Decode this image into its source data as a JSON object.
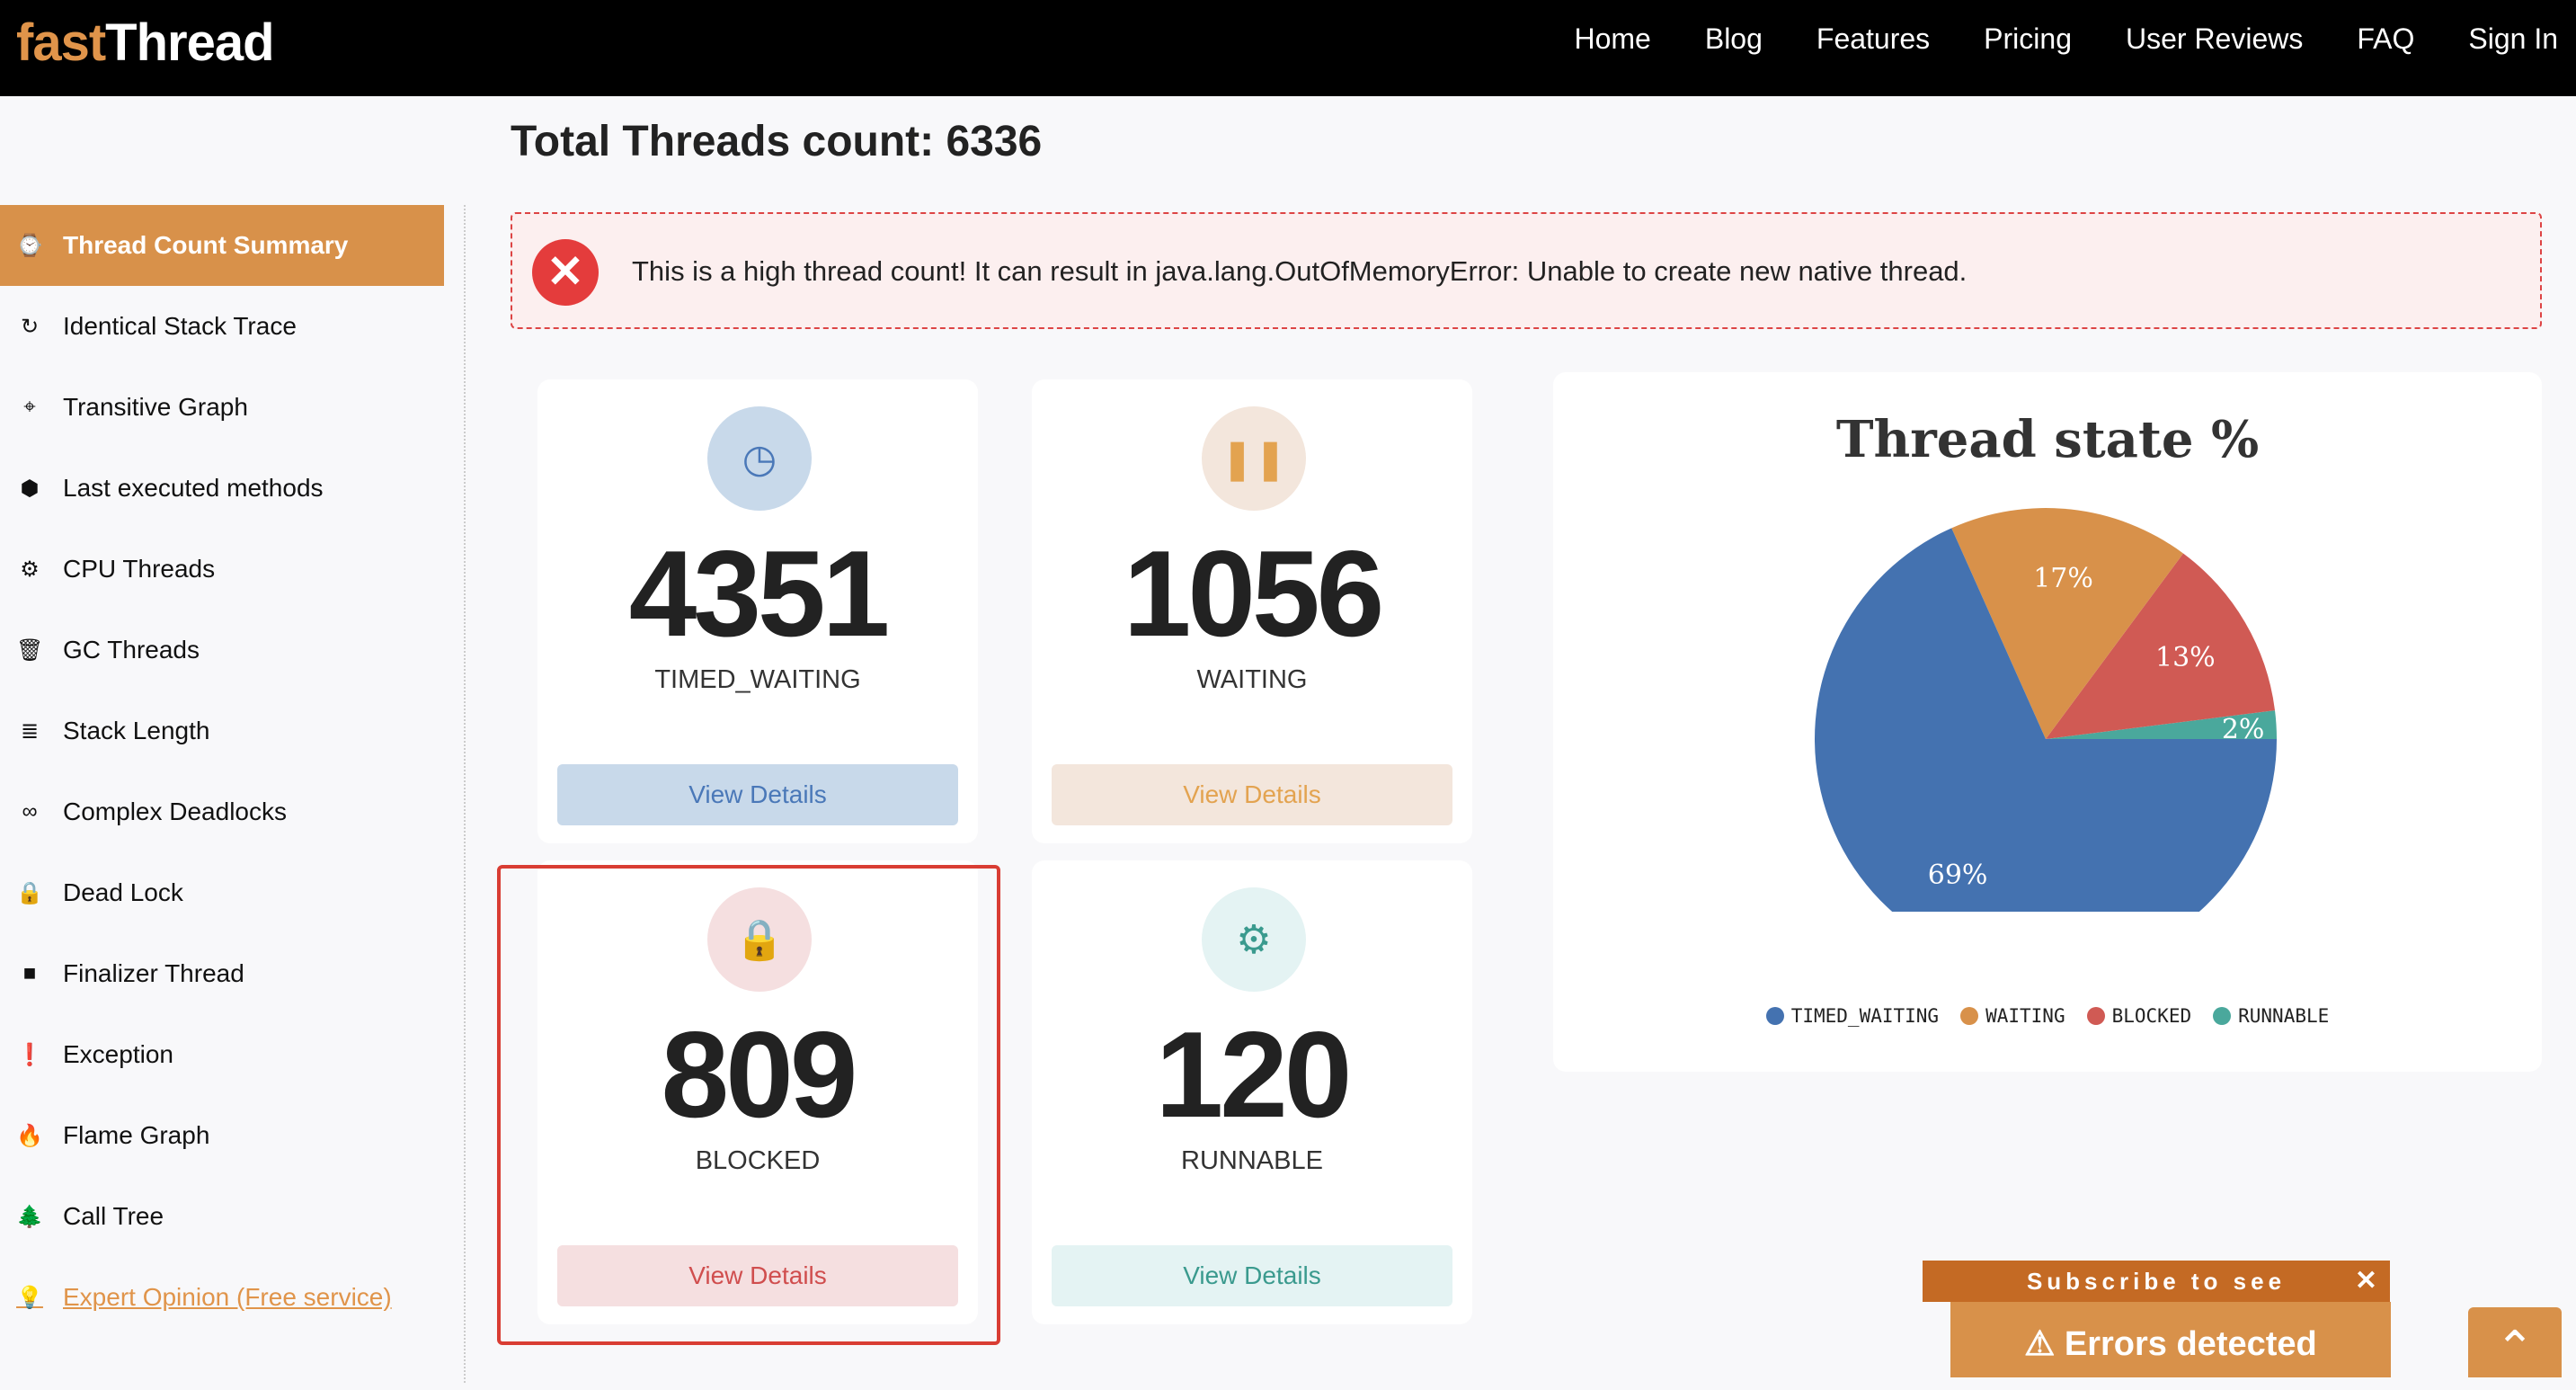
{
  "brand": {
    "part1": "fast",
    "part2": "Thread"
  },
  "nav": [
    "Home",
    "Blog",
    "Features",
    "Pricing",
    "User Reviews",
    "FAQ",
    "Sign In"
  ],
  "sidebar": [
    {
      "label": "Thread Count Summary",
      "icon": "dashboard-icon",
      "glyph": "⌚"
    },
    {
      "label": "Identical Stack Trace",
      "icon": "refresh-icon",
      "glyph": "↻"
    },
    {
      "label": "Transitive Graph",
      "icon": "crosshair-icon",
      "glyph": "⌖"
    },
    {
      "label": "Last executed methods",
      "icon": "cubes-icon",
      "glyph": "⬢"
    },
    {
      "label": "CPU Threads",
      "icon": "cogs-icon",
      "glyph": "⚙"
    },
    {
      "label": "GC Threads",
      "icon": "trash-icon",
      "glyph": "🗑"
    },
    {
      "label": "Stack Length",
      "icon": "sort-icon",
      "glyph": "≣"
    },
    {
      "label": "Complex Deadlocks",
      "icon": "link-icon",
      "glyph": "∞"
    },
    {
      "label": "Dead Lock",
      "icon": "lock-icon",
      "glyph": "🔒"
    },
    {
      "label": "Finalizer Thread",
      "icon": "square-icon",
      "glyph": "■"
    },
    {
      "label": "Exception",
      "icon": "exclamation-icon",
      "glyph": "❗"
    },
    {
      "label": "Flame Graph",
      "icon": "fire-icon",
      "glyph": "🔥"
    },
    {
      "label": "Call Tree",
      "icon": "tree-icon",
      "glyph": "🌲"
    }
  ],
  "expert": {
    "label": "Expert Opinion (Free service)",
    "icon": "lightbulb-icon",
    "glyph": "💡"
  },
  "page_title": "Total Threads count: 6336",
  "alert": "This is a high thread count! It can result in java.lang.OutOfMemoryError: Unable to create new native thread.",
  "cards": [
    {
      "count": "4351",
      "label": "TIMED_WAITING",
      "button": "View Details",
      "icon": "clock-icon",
      "glyph": "◷",
      "color": "#4a78b8",
      "bg": "#c8d9ea"
    },
    {
      "count": "1056",
      "label": "WAITING",
      "button": "View Details",
      "icon": "pause-icon",
      "glyph": "❚❚",
      "color": "#e3a350",
      "bg": "#f3e6dc"
    },
    {
      "count": "809",
      "label": "BLOCKED",
      "button": "View Details",
      "icon": "lock-icon",
      "glyph": "🔒",
      "color": "#d04e4e",
      "bg": "#f5dfe0"
    },
    {
      "count": "120",
      "label": "RUNNABLE",
      "button": "View Details",
      "icon": "gear-icon",
      "glyph": "⚙",
      "color": "#3a9a8e",
      "bg": "#e4f3f3"
    }
  ],
  "chart_data": {
    "type": "pie",
    "title": "Thread state %",
    "categories": [
      "TIMED_WAITING",
      "WAITING",
      "BLOCKED",
      "RUNNABLE"
    ],
    "values": [
      69,
      17,
      13,
      2
    ],
    "labels": [
      "69%",
      "17%",
      "13%",
      "2%"
    ],
    "colors": [
      "#4472b0",
      "#d8914a",
      "#d05a54",
      "#4aa89c"
    ],
    "legend": "bottom"
  },
  "subscribe": {
    "text": "Subscribe to see",
    "close": "✕"
  },
  "errors": "⚠ Errors detected",
  "scroll_top": "⌃"
}
